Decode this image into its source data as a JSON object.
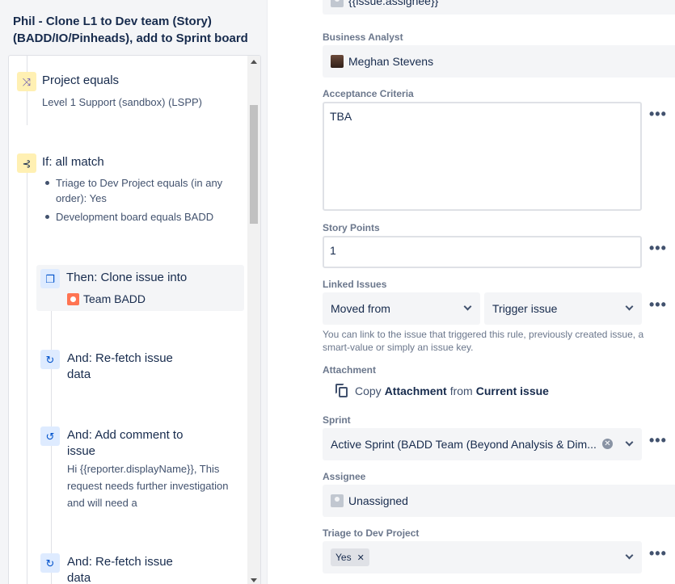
{
  "rule": {
    "title": "Phil - Clone L1 to Dev team (Story) (BADD/IO/Pinheads), add to Sprint board",
    "components": {
      "project_condition": {
        "title": "Project equals",
        "subtitle": "Level 1 Support (sandbox) (LSPP)",
        "icon": "shuffle-icon"
      },
      "if_block": {
        "title": "If: all match",
        "icon": "branch-icon",
        "conditions": [
          "Triage to Dev Project equals (in any order): Yes",
          "Development board equals BADD"
        ]
      },
      "clone_action": {
        "title": "Then: Clone issue into",
        "subtitle": "Team BADD",
        "icon": "copy-icon"
      },
      "refetch_1": {
        "title": "And: Re-fetch issue data",
        "icon": "refresh-icon"
      },
      "comment_action": {
        "title": "And: Add comment to issue",
        "subtitle": "Hi {{reporter.displayName}}, This request needs further investigation and will need a",
        "icon": "comment-refresh-icon"
      },
      "refetch_2": {
        "title": "And: Re-fetch issue data",
        "icon": "refresh-icon"
      }
    }
  },
  "form": {
    "assignee_top_value": "{{issue.assignee}}",
    "business_analyst": {
      "label": "Business Analyst",
      "value": "Meghan Stevens"
    },
    "acceptance_criteria": {
      "label": "Acceptance Criteria",
      "value": "TBA"
    },
    "story_points": {
      "label": "Story Points",
      "value": "1"
    },
    "linked_issues": {
      "label": "Linked Issues",
      "link_type": "Moved from",
      "target": "Trigger issue",
      "help": "You can link to the issue that triggered this rule, previously created issue, a smart-value or simply an issue key."
    },
    "attachment": {
      "label": "Attachment",
      "prefix": "Copy",
      "bold1": "Attachment",
      "middle": "from",
      "bold2": "Current issue"
    },
    "sprint": {
      "label": "Sprint",
      "value": "Active Sprint (BADD Team (Beyond Analysis & Dim..."
    },
    "assignee": {
      "label": "Assignee",
      "value": "Unassigned"
    },
    "triage": {
      "label": "Triage to Dev Project",
      "tag": "Yes"
    }
  },
  "colors": {
    "panel_bg": "#f4f5f7",
    "accent_blue": "#0052cc",
    "condition_yellow": "#fff0b3",
    "team_icon": "#ff7452"
  }
}
